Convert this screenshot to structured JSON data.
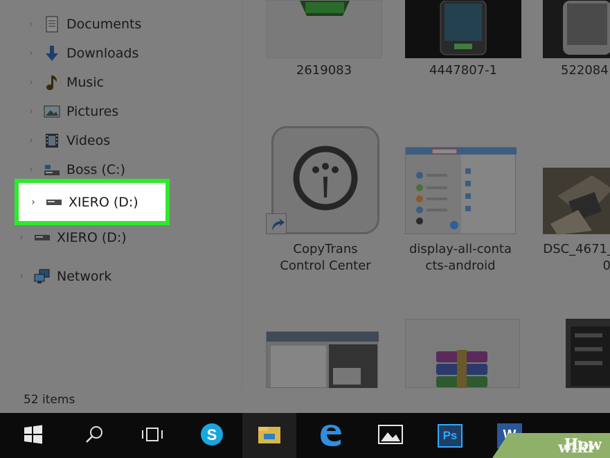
{
  "nav": {
    "items": [
      {
        "label": "Documents",
        "icon": "documents-icon"
      },
      {
        "label": "Downloads",
        "icon": "downloads-icon"
      },
      {
        "label": "Music",
        "icon": "music-icon"
      },
      {
        "label": "Pictures",
        "icon": "pictures-icon"
      },
      {
        "label": "Videos",
        "icon": "videos-icon"
      },
      {
        "label": "Boss (C:)",
        "icon": "drive-c-icon"
      }
    ],
    "highlighted": {
      "label": "XIERO (D:)",
      "icon": "drive-d-icon"
    },
    "below": [
      {
        "label": "XIERO (D:)",
        "icon": "drive-d-icon"
      },
      {
        "label": "Network",
        "icon": "network-icon"
      }
    ]
  },
  "files": [
    {
      "name": "2619083"
    },
    {
      "name": "4447807-1"
    },
    {
      "name": "522084"
    },
    {
      "name_line1": "CopyTrans",
      "name_line2": "Control Center"
    },
    {
      "name_line1": "display-all-conta",
      "name_line2": "cts-android"
    },
    {
      "name_line1": "DSC_4671_",
      "name_line2": "0"
    }
  ],
  "status": {
    "count": "52 items"
  },
  "taskbar": {
    "apps": [
      "start-icon",
      "search-icon",
      "task-view-icon",
      "skype-icon",
      "file-explorer-icon",
      "edge-icon",
      "photos-icon",
      "photoshop-icon",
      "word-icon"
    ],
    "ps_label": "Ps",
    "w_label": "W"
  },
  "watermark": {
    "wiki": "wiki",
    "how": "How"
  },
  "colors": {
    "highlight": "#2eea2a",
    "taskbar": "#0b0b0b",
    "dim": "#7f7f7f"
  }
}
